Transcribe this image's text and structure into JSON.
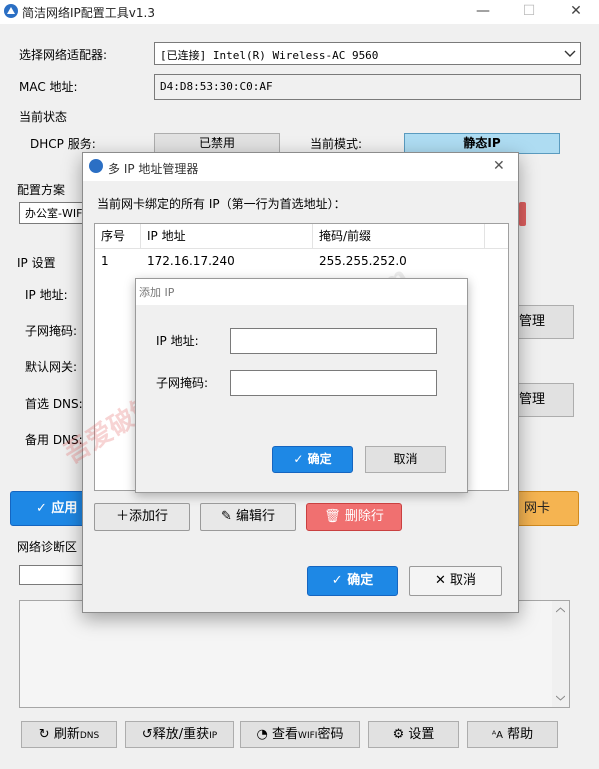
{
  "window": {
    "title": "简洁网络IP配置工具v1.3",
    "minimize": "—",
    "maximize": "☐",
    "close": "✕"
  },
  "adapter": {
    "label": "选择网络适配器:",
    "value": "[已连接] Intel(R) Wireless-AC 9560",
    "dropdown_icon": "chevron-down"
  },
  "mac": {
    "label": "MAC 地址:",
    "value": "D4:D8:53:30:C0:AF"
  },
  "status": {
    "group_title": "当前状态",
    "dhcp_label": "DHCP 服务:",
    "dhcp_value": "已禁用",
    "mode_label": "当前模式:",
    "mode_value": "静态IP"
  },
  "profile": {
    "group_title": "配置方案",
    "value": "办公室-WIFI"
  },
  "ipsettings": {
    "group_title": "IP 设置",
    "ip_label": "IP 地址:",
    "mask_label": "子网掩码:",
    "gateway_label": "默认网关:",
    "dns1_label": "首选 DNS:",
    "dns2_label": "备用 DNS:",
    "manage_btn1": "管理",
    "manage_btn2": "管理"
  },
  "actions": {
    "apply": "✓ 应用",
    "nic": "网卡"
  },
  "diagnostics": {
    "group_title": "网络诊断区"
  },
  "bottom_bar": {
    "refresh_dns": "刷新",
    "refresh_dns_small": "DNS",
    "release": "释放/重获",
    "release_small": "IP",
    "wifi": "查看",
    "wifi_small": "WIFI",
    "wifi_tail": "密码",
    "settings": "设置",
    "help": "帮助"
  },
  "dialog": {
    "title": "多 IP 地址管理器",
    "close": "✕",
    "description": "当前网卡绑定的所有 IP（第一行为首选地址）：",
    "columns": [
      "序号",
      "IP 地址",
      "掩码/前缀"
    ],
    "rows": [
      {
        "index": "1",
        "ip": "172.16.17.240",
        "mask": "255.255.252.0"
      }
    ],
    "add_row": "添加行",
    "edit_row": "编辑行",
    "delete_row": "删除行",
    "ok": "确定",
    "cancel": "取消"
  },
  "add_ip": {
    "title": "添加 IP",
    "ip_label": "IP 地址:",
    "ip_value": "",
    "mask_label": "子网掩码:",
    "mask_value": "",
    "ok": "确定",
    "cancel": "取消"
  },
  "watermark": {
    "line1": "吾爱破解 收录",
    "line2": "Hypase.com"
  },
  "colors": {
    "accent_blue": "#1e88e5",
    "mode_badge": "#aedcf2",
    "orange": "#f5b451",
    "danger": "#f07070"
  }
}
